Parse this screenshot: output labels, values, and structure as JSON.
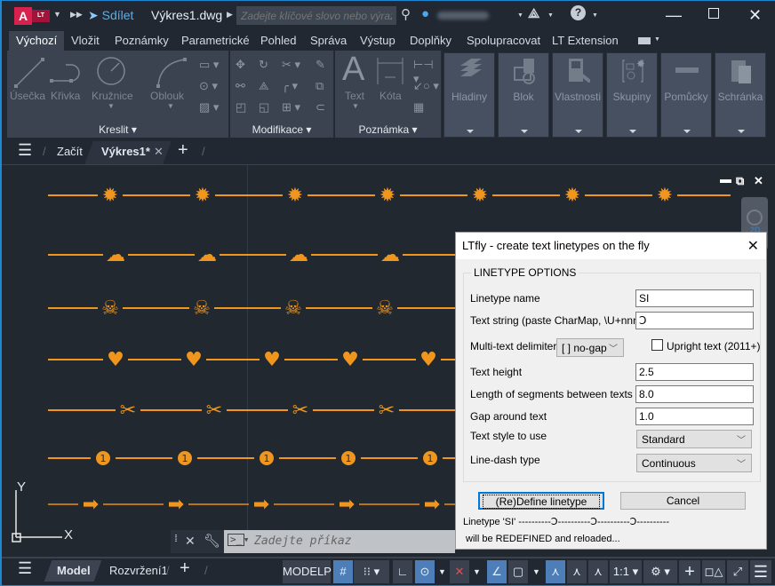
{
  "titlebar": {
    "app_badge": "A",
    "app_edition": "LT",
    "share_label": "Sdílet",
    "filename": "Výkres1.dwg",
    "search_placeholder": "Zadejte klíčové slovo nebo výraz.",
    "icons": [
      "search-icon",
      "user-icon",
      "autodesk-app-icon",
      "help-icon",
      "minimize-icon",
      "maximize-icon",
      "close-icon"
    ]
  },
  "ribbon_tabs": [
    "Výchozí",
    "Vložit",
    "Poznámky",
    "Parametrické",
    "Pohled",
    "Správa",
    "Výstup",
    "Doplňky",
    "Spolupracovat",
    "LT Extension"
  ],
  "ribbon_tab_active": "Výchozí",
  "ribbon": {
    "kreslit": {
      "title": "Kreslit",
      "tools": [
        "Úsečka",
        "Křivka",
        "Kružnice",
        "Oblouk"
      ]
    },
    "modifikace": {
      "title": "Modifikace"
    },
    "poznamka": {
      "title": "Poznámka",
      "tools": [
        "Text",
        "Kóta"
      ]
    },
    "collapsed_panels": [
      "Hladiny",
      "Blok",
      "Vlastnosti",
      "Skupiny",
      "Pomůcky",
      "Schránka"
    ]
  },
  "doc_tabs": {
    "start": "Začít",
    "active": "Výkres1*"
  },
  "drawing": {
    "linetype_color": "#f0961e",
    "rows": [
      {
        "symbol": "sun",
        "glyph": "✹"
      },
      {
        "symbol": "cloud",
        "glyph": "☁"
      },
      {
        "symbol": "skull",
        "glyph": "☠"
      },
      {
        "symbol": "heart",
        "glyph": "♥"
      },
      {
        "symbol": "scissors",
        "glyph": "✂"
      },
      {
        "symbol": "circled-one",
        "glyph": "1"
      },
      {
        "symbol": "arrow",
        "glyph": "➡"
      }
    ],
    "ucs": {
      "x_label": "X",
      "y_label": "Y"
    },
    "navcube_label": "2D"
  },
  "command_line": {
    "placeholder": "Zadejte příkaz"
  },
  "dialog": {
    "title": "LTfly - create text linetypes on the fly",
    "group_title": "LINETYPE OPTIONS",
    "fields": {
      "linetype_name": {
        "label": "Linetype name",
        "value": "SI"
      },
      "text_string": {
        "label": "Text string (paste CharMap, \\U+nnnn)",
        "value": "Ↄ"
      },
      "delimiter": {
        "label": "Multi-text delimiter:",
        "value": "[ ] no-gap"
      },
      "upright": {
        "label": "Upright text (2011+)",
        "checked": false
      },
      "text_height": {
        "label": "Text height",
        "value": "2.5"
      },
      "segment_length": {
        "label": "Length of segments between texts",
        "value": "8.0"
      },
      "gap": {
        "label": "Gap around text",
        "value": "1.0"
      },
      "text_style": {
        "label": "Text style to use",
        "value": "Standard"
      },
      "dash_type": {
        "label": "Line-dash type",
        "value": "Continuous"
      }
    },
    "define_button": "(Re)Define linetype",
    "cancel_button": "Cancel",
    "preview": "Linetype 'SI' ----------Ↄ----------Ↄ----------Ↄ----------",
    "status": "will be REDEFINED and reloaded..."
  },
  "statusbar": {
    "model_tab": "Model",
    "layout_tab": "Rozvržení1",
    "modelp": "MODELP",
    "scale": "1:1"
  }
}
